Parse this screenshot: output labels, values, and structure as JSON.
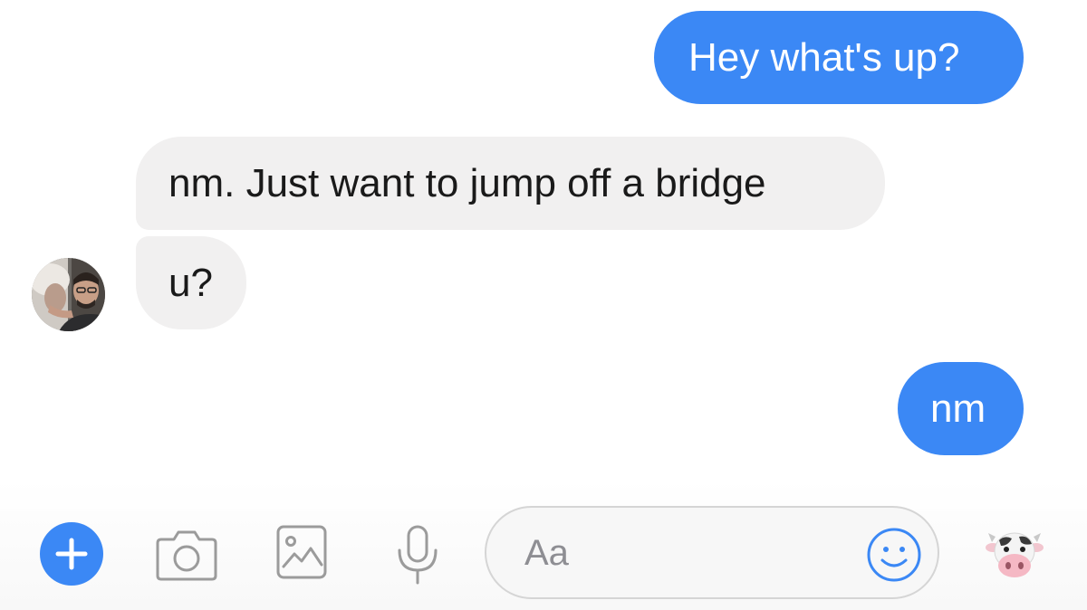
{
  "conversation": {
    "messages": [
      {
        "direction": "outgoing",
        "text": "Hey what's up?"
      },
      {
        "direction": "incoming",
        "text": "nm. Just want to jump off a bridge"
      },
      {
        "direction": "incoming",
        "text": "u?"
      },
      {
        "direction": "outgoing",
        "text": "nm"
      }
    ]
  },
  "composer": {
    "placeholder": "Aa",
    "icons": [
      "plus-icon",
      "camera-icon",
      "image-icon",
      "microphone-icon",
      "smiley-icon",
      "cow-icon"
    ]
  },
  "colors": {
    "outgoing_bubble": "#3b88f5",
    "incoming_bubble": "#f1f0f0",
    "icon_gray": "#9b9b9b",
    "accent": "#3b88f5"
  }
}
